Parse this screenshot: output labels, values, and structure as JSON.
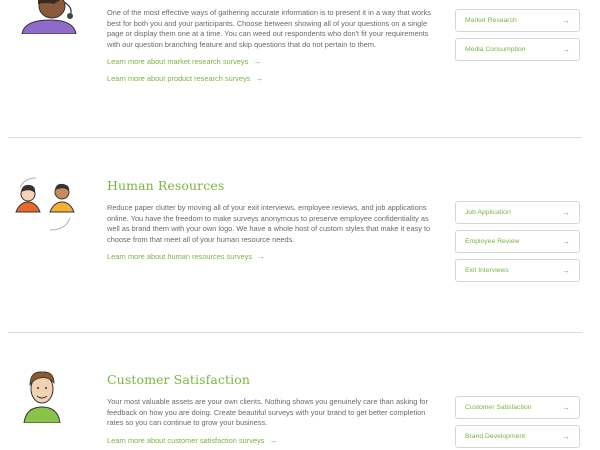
{
  "sections": [
    {
      "heading": "",
      "description": "One of the most effective ways of gathering accurate information is to present it in a way that works best for both you and your participants. Choose between showing all of your questions on a single page or display them one at a time. You can weed out respondents who don't fit your requirements with our question branching feature and skip questions that do not pertain to them.",
      "links": [
        "Learn more about market research surveys",
        "Learn more about product research surveys"
      ],
      "buttons": [
        "Market Research",
        "Media Consumption"
      ]
    },
    {
      "heading": "Human Resources",
      "description": "Reduce paper clutter by moving all of your exit interviews, employee reviews, and job applications online. You have the freedom to make surveys anonymous to preserve employee confidentiality as well as brand them with your own logo. We have a whole host of custom styles that make it easy to choose from that meet all of your human resource needs.",
      "links": [
        "Learn more about human resources surveys"
      ],
      "buttons": [
        "Job Application",
        "Employee Review",
        "Exit Interviews"
      ]
    },
    {
      "heading": "Customer Satisfaction",
      "description": "Your most valuable assets are your own clients. Nothing shows you genuinely care than asking for feedback on how you are doing. Create beautiful surveys with your brand to get better completion rates so you can continue to grow your business.",
      "links": [
        "Learn more about customer satisfaction surveys"
      ],
      "buttons": [
        "Customer Satisfaction",
        "Brand Development"
      ]
    }
  ],
  "arrow_glyph": "→",
  "colors": {
    "accent": "#7cb342",
    "text": "#6a6a6a",
    "border": "#d6d6d6"
  }
}
